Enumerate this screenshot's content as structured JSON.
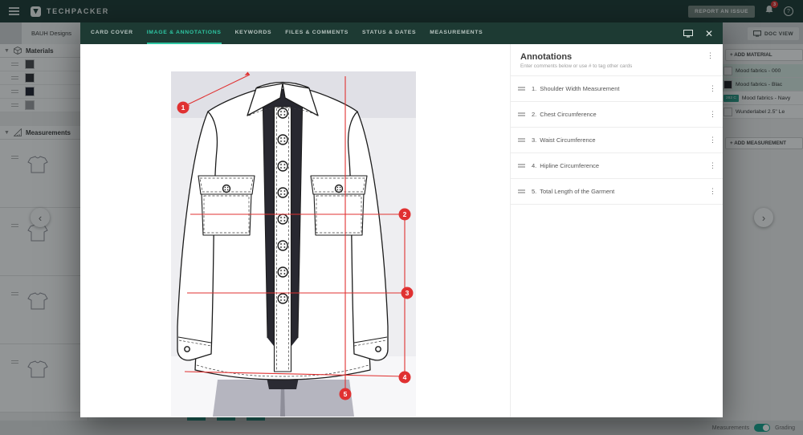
{
  "colors": {
    "brand_dark": "#1d3a33",
    "accent_teal": "#2ec5a2",
    "annotation_red": "#e03131",
    "pantone_chip": "#2aa08c"
  },
  "topbar": {
    "brand": "TECHPACKER",
    "report_issue_label": "REPORT AN ISSUE",
    "notification_count": "3",
    "help_label": "?"
  },
  "subbar": {
    "project_tab": "BAUH Designs",
    "doc_view_label": "DOC VIEW"
  },
  "sidebar": {
    "materials_header": "Materials",
    "measurements_header": "Measurements"
  },
  "right_panel": {
    "add_material_label": "+ ADD MATERIAL",
    "add_measurement_label": "+ ADD MEASUREMENT",
    "material_rows": [
      {
        "swatch_label": "",
        "label": "Mood fabrics -  000"
      },
      {
        "swatch_label": "",
        "label": "Mood fabrics -  Blac"
      },
      {
        "swatch_label": "282 C",
        "label": "Mood fabrics -  Navy"
      },
      {
        "swatch_label": "",
        "label": "Wunderlabel 2.5\" Le"
      }
    ]
  },
  "footer": {
    "measurements_label": "Measurements",
    "grading_label": "Grading"
  },
  "modal": {
    "tabs": [
      {
        "label": "CARD COVER"
      },
      {
        "label": "IMAGE & ANNOTATIONS"
      },
      {
        "label": "KEYWORDS"
      },
      {
        "label": "FILES & COMMENTS"
      },
      {
        "label": "STATUS & DATES"
      },
      {
        "label": "MEASUREMENTS"
      }
    ],
    "active_tab": "IMAGE & ANNOTATIONS",
    "annotations": {
      "title": "Annotations",
      "subtitle": "Enter comments below or use # to tag other cards",
      "items": [
        {
          "number": "1.",
          "label": "Shoulder Width Measurement"
        },
        {
          "number": "2.",
          "label": "Chest Circumference"
        },
        {
          "number": "3.",
          "label": "Waist Circumference"
        },
        {
          "number": "4.",
          "label": "Hipline Circumference"
        },
        {
          "number": "5.",
          "label": "Total Length of the Garment"
        }
      ]
    },
    "markers": [
      "1",
      "2",
      "3",
      "4",
      "5"
    ]
  }
}
